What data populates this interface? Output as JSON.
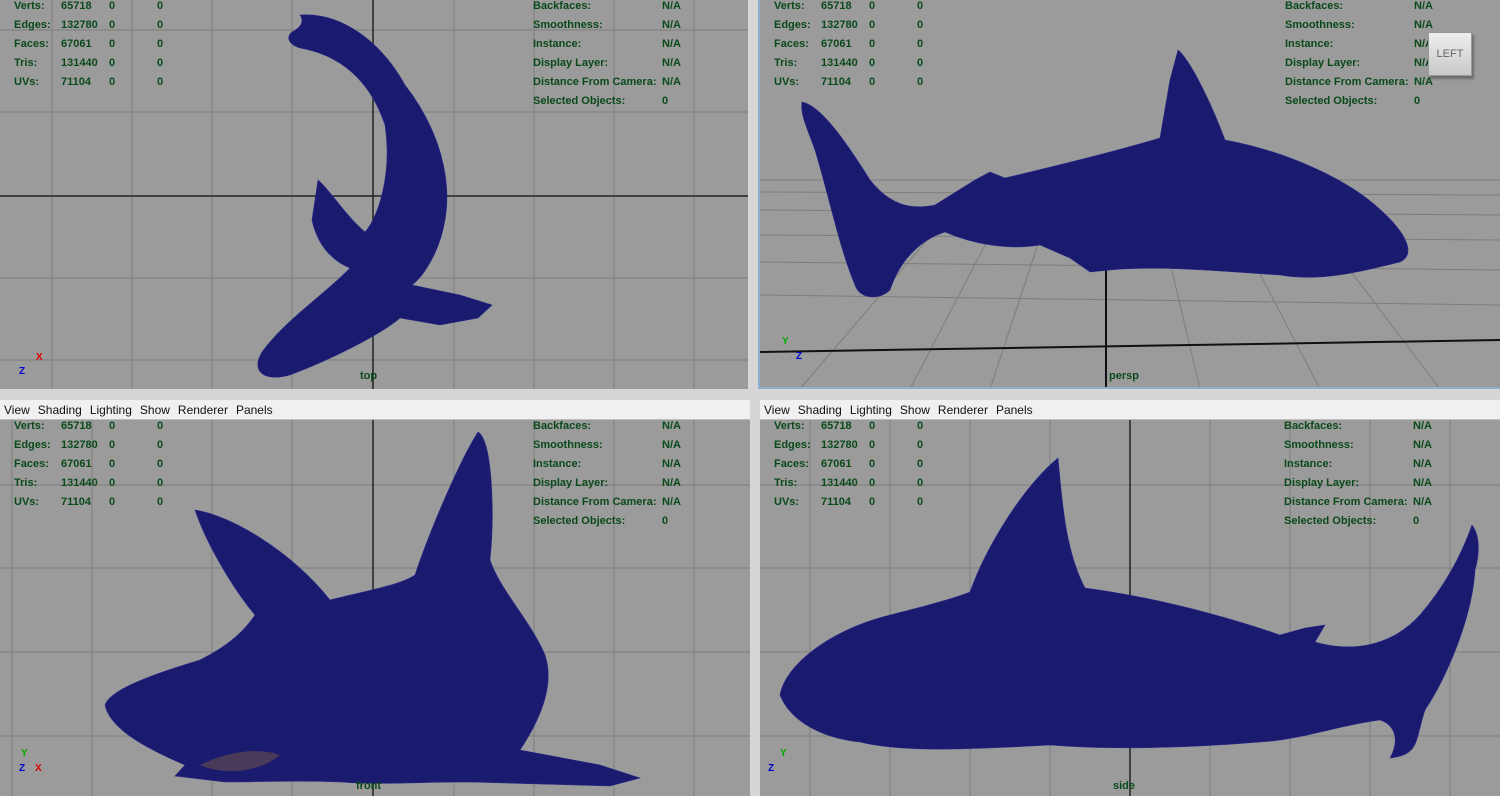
{
  "menubar": [
    "View",
    "Shading",
    "Lighting",
    "Show",
    "Renderer",
    "Panels"
  ],
  "stats": {
    "rows": [
      {
        "label": "Verts:",
        "v1": "65718",
        "v2": "0",
        "v3": "0"
      },
      {
        "label": "Edges:",
        "v1": "132780",
        "v2": "0",
        "v3": "0"
      },
      {
        "label": "Faces:",
        "v1": "67061",
        "v2": "0",
        "v3": "0"
      },
      {
        "label": "Tris:",
        "v1": "131440",
        "v2": "0",
        "v3": "0"
      },
      {
        "label": "UVs:",
        "v1": "71104",
        "v2": "0",
        "v3": "0"
      }
    ]
  },
  "info": {
    "rows": [
      {
        "label": "Backfaces:",
        "value": "N/A"
      },
      {
        "label": "Smoothness:",
        "value": "N/A"
      },
      {
        "label": "Instance:",
        "value": "N/A"
      },
      {
        "label": "Display Layer:",
        "value": "N/A"
      },
      {
        "label": "Distance From Camera:",
        "value": "N/A"
      },
      {
        "label": "Selected Objects:",
        "value": "0"
      }
    ]
  },
  "viewports": {
    "top": {
      "camera": "top"
    },
    "persp": {
      "camera": "persp",
      "view_cube": "LEFT"
    },
    "front": {
      "camera": "front"
    },
    "side": {
      "camera": "side"
    }
  },
  "axes": {
    "x": "X",
    "y": "Y",
    "z": "Z"
  },
  "colors": {
    "viewport_bg": "#9b9b9b",
    "mesh": "#1a1a6e",
    "hud_text": "#0a4a1a",
    "grid": "#7d7d7d"
  }
}
